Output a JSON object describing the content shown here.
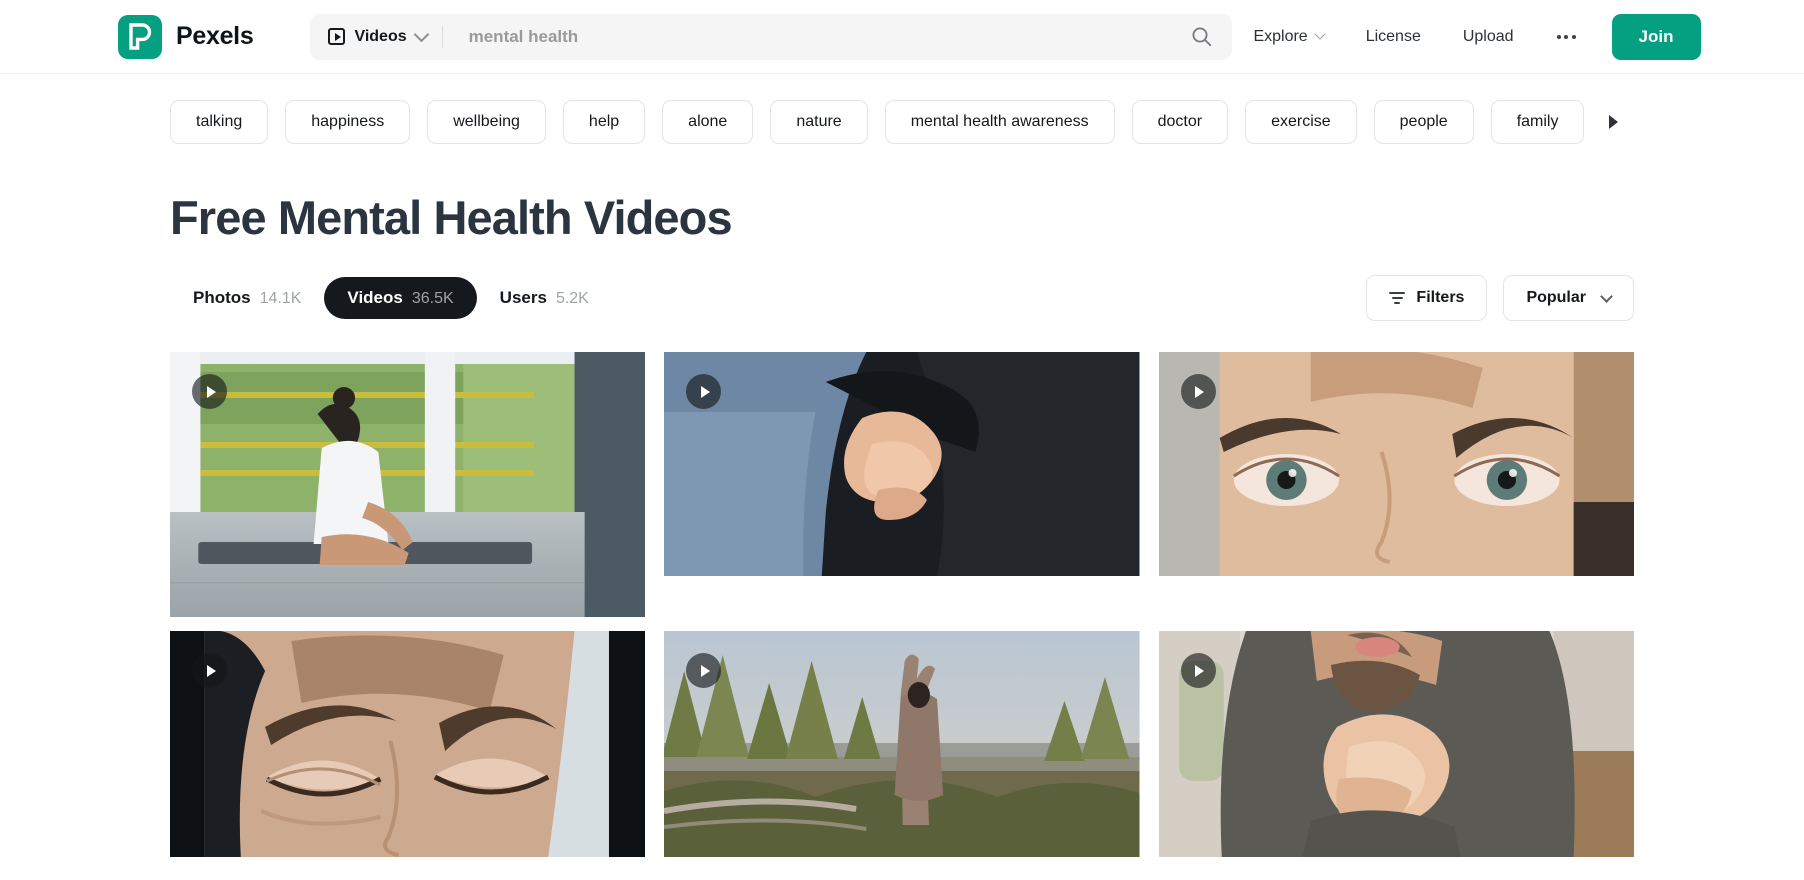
{
  "header": {
    "brand_name": "Pexels",
    "logo_icon": "pexels-p-logo-icon",
    "media_type_label": "Videos",
    "media_type_icon": "video-play-box-icon",
    "chevron_icon": "chevron-down-icon",
    "search_value": "",
    "search_placeholder": "mental health",
    "search_icon": "search-icon",
    "nav": [
      {
        "label": "Explore",
        "has_chevron": true
      },
      {
        "label": "License",
        "has_chevron": false
      },
      {
        "label": "Upload",
        "has_chevron": false
      }
    ],
    "more_icon": "ellipsis-icon",
    "join_label": "Join",
    "accent_color": "#05a081"
  },
  "tags": [
    "talking",
    "happiness",
    "wellbeing",
    "help",
    "alone",
    "nature",
    "mental health awareness",
    "doctor",
    "exercise",
    "people",
    "family"
  ],
  "tag_scroll_arrow_icon": "chevron-right-icon",
  "main": {
    "page_title": "Free Mental Health Videos",
    "tabs": [
      {
        "label": "Photos",
        "count": "14.1K",
        "active": false
      },
      {
        "label": "Videos",
        "count": "36.5K",
        "active": true
      },
      {
        "label": "Users",
        "count": "5.2K",
        "active": false
      }
    ],
    "filters_label": "Filters",
    "filters_icon": "filter-sliders-icon",
    "sort_label": "Popular",
    "sort_icon": "chevron-down-icon"
  },
  "results": [
    {
      "alt": "Woman meditating in lotus pose on a mat on an open terrace overlooking green rice fields",
      "badge_icon": "play-icon"
    },
    {
      "alt": "Close-up of clasped hands resting on denim jeans in a dark room",
      "badge_icon": "play-icon"
    },
    {
      "alt": "Extreme close-up of a man's green-blue eyes looking at the camera",
      "badge_icon": "play-icon"
    },
    {
      "alt": "Close-up of a person's face with eyes closed lit in cool blue tones",
      "badge_icon": "play-icon"
    },
    {
      "alt": "Woman stretching arms overhead on a hilltop trail at sunset with pine trees",
      "badge_icon": "play-icon"
    },
    {
      "alt": "Bearded man in a grey sweater with hands clasped together indoors",
      "badge_icon": "play-icon"
    }
  ]
}
